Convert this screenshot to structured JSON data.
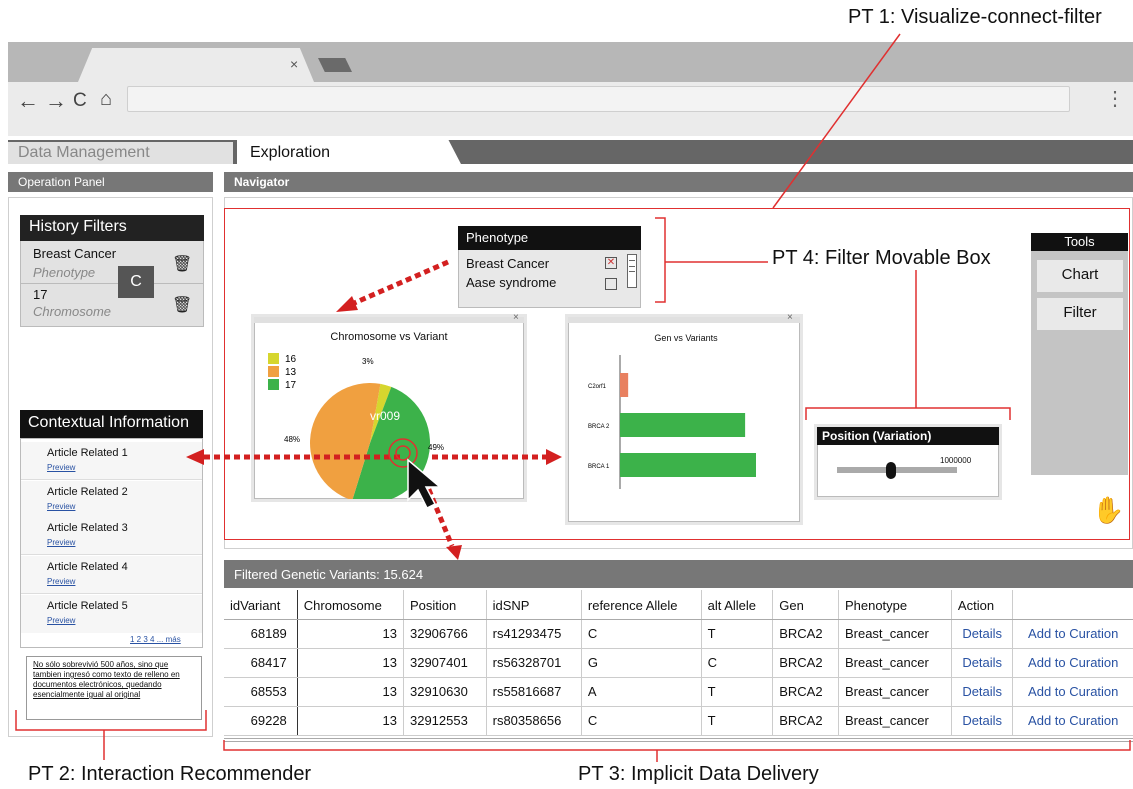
{
  "annotations": {
    "pt1": "PT 1: Visualize-connect-filter",
    "pt2": "PT 2: Interaction Recommender",
    "pt3": "PT 3: Implicit Data Delivery",
    "pt4": "PT 4: Filter Movable Box"
  },
  "browser": {
    "tab_close": "×",
    "back": "←",
    "forward": "→",
    "reload": "C",
    "home": "⌂",
    "menu": "⋮"
  },
  "app_tabs": [
    "Data Management",
    "Exploration"
  ],
  "operation_panel": {
    "title": "Operation Panel",
    "history": {
      "title": "History Filters",
      "items": [
        {
          "value": "Breast Cancer",
          "type": "Phenotype"
        },
        {
          "value": "17",
          "type": "Chromosome"
        }
      ],
      "badge": "C"
    },
    "contextual": {
      "title": "Contextual Information",
      "articles": [
        "Article Related 1",
        "Article Related 2",
        "Article Related 3",
        "Article Related 4",
        "Article Related 5"
      ],
      "preview_label": "Preview",
      "pagination": "1 2 3 4 ... más",
      "note": "No sólo sobrevivió 500 años, sino que tambien ingresó como texto de relleno en documentos electrónicos, quedando esencialmente igual al original"
    }
  },
  "navigator": {
    "title": "Navigator",
    "phenotype": {
      "title": "Phenotype",
      "options": [
        {
          "label": "Breast Cancer",
          "checked": true
        },
        {
          "label": "Aase syndrome",
          "checked": false
        }
      ]
    },
    "position": {
      "title": "Position (Variation)",
      "value": "1000000",
      "fraction": 0.45
    },
    "tools": {
      "title": "Tools",
      "buttons": [
        "Chart",
        "Filter"
      ]
    }
  },
  "chart_data": [
    {
      "type": "pie",
      "title": "Chromosome vs Variant",
      "legend": [
        "16",
        "13",
        "17"
      ],
      "colors": [
        "#d6d62e",
        "#f0a040",
        "#3cb24a"
      ],
      "values": [
        3,
        48,
        49
      ],
      "labels": [
        "3%",
        "48%",
        "49%"
      ],
      "highlight_label": "vr009"
    },
    {
      "type": "bar",
      "title": "Gen vs Variants",
      "categories": [
        "C2orf1",
        "BRCA 2",
        "BRCA 1"
      ],
      "values": [
        0.06,
        0.92,
        1.0
      ],
      "colors": [
        "#e88060",
        "#3cb24a",
        "#3cb24a"
      ]
    }
  ],
  "table": {
    "title": "Filtered Genetic Variants: 15.624",
    "columns": [
      "idVariant",
      "Chromosome",
      "Position",
      "idSNP",
      "reference Allele",
      "alt Allele",
      "Gen",
      "Phenotype",
      "Action",
      ""
    ],
    "rows": [
      [
        "68189",
        "13",
        "32906766",
        "rs41293475",
        "C",
        "T",
        "BRCA2",
        "Breast_cancer",
        "Details",
        "Add to Curation"
      ],
      [
        "68417",
        "13",
        "32907401",
        "rs56328701",
        "G",
        "C",
        "BRCA2",
        "Breast_cancer",
        "Details",
        "Add to Curation"
      ],
      [
        "68553",
        "13",
        "32910630",
        "rs55816687",
        "A",
        "T",
        "BRCA2",
        "Breast_cancer",
        "Details",
        "Add to Curation"
      ],
      [
        "69228",
        "13",
        "32912553",
        "rs80358656",
        "C",
        "T",
        "BRCA2",
        "Breast_cancer",
        "Details",
        "Add to Curation"
      ]
    ]
  }
}
